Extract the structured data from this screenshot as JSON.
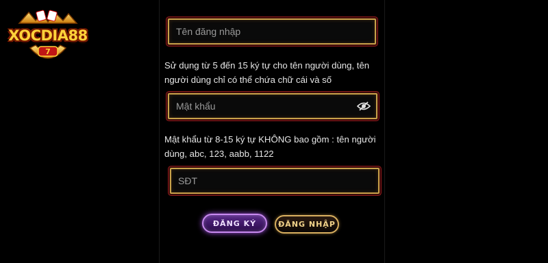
{
  "brand": {
    "logo_text": "XOCDIA88"
  },
  "form": {
    "username": {
      "placeholder": "Tên đăng nhập",
      "value": ""
    },
    "username_help": "Sử dụng từ 5 đến 15 ký tự cho tên người dùng, tên người dùng chỉ có thể chứa chữ cái và số",
    "password": {
      "placeholder": "Mật khẩu",
      "value": ""
    },
    "password_help": "Mật khẩu từ 8-15 ký tự KHÔNG bao gồm : tên người dùng, abc, 123, aabb, 1122",
    "phone": {
      "placeholder": "SĐT",
      "value": ""
    },
    "register_label": "ĐĂNG KÝ",
    "login_label": "ĐĂNG NHẬP"
  },
  "icons": {
    "password_toggle": "eye-slash-icon"
  },
  "colors": {
    "field_border": "#c8a24a",
    "register_accent": "#c98af0",
    "login_accent": "#d9b060",
    "background": "#000000"
  }
}
